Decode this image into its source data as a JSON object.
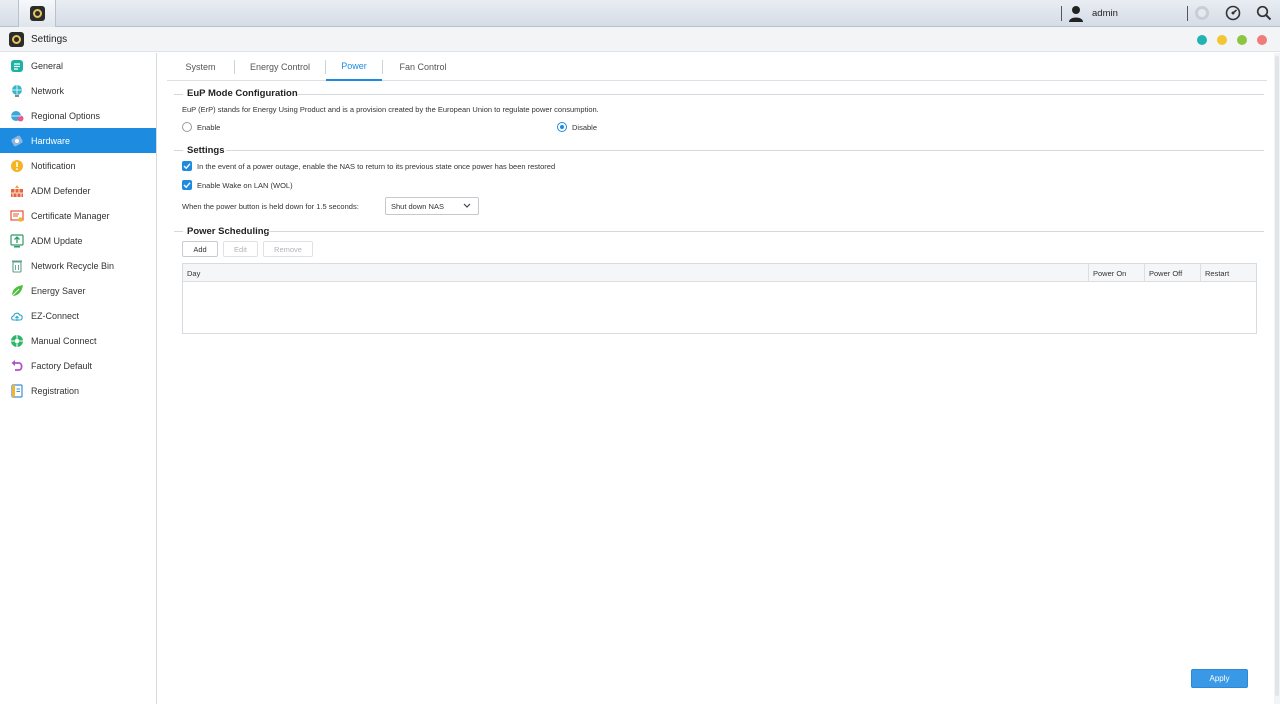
{
  "taskbar": {
    "username": "admin",
    "app_icon": "settings-gear-icon",
    "icons": [
      "user-icon",
      "notification-icon",
      "dashboard-icon",
      "search-icon"
    ]
  },
  "window": {
    "title": "Settings",
    "controls": [
      {
        "name": "teal",
        "color": "#21b3b3"
      },
      {
        "name": "yellow",
        "color": "#f2c531"
      },
      {
        "name": "green",
        "color": "#8cc63f"
      },
      {
        "name": "red",
        "color": "#f07b7b"
      }
    ]
  },
  "sidebar": {
    "active": "Hardware",
    "items": [
      {
        "label": "General",
        "icon": "general-icon"
      },
      {
        "label": "Network",
        "icon": "network-globe-icon"
      },
      {
        "label": "Regional Options",
        "icon": "regional-globe-icon"
      },
      {
        "label": "Hardware",
        "icon": "hardware-icon"
      },
      {
        "label": "Notification",
        "icon": "notification-icon"
      },
      {
        "label": "ADM Defender",
        "icon": "defender-firewall-icon"
      },
      {
        "label": "Certificate Manager",
        "icon": "certificate-icon"
      },
      {
        "label": "ADM Update",
        "icon": "update-icon"
      },
      {
        "label": "Network Recycle Bin",
        "icon": "recycle-bin-icon"
      },
      {
        "label": "Energy Saver",
        "icon": "energy-leaf-icon"
      },
      {
        "label": "EZ-Connect",
        "icon": "cloud-upload-icon"
      },
      {
        "label": "Manual Connect",
        "icon": "manual-connect-icon"
      },
      {
        "label": "Factory Default",
        "icon": "undo-arrow-icon"
      },
      {
        "label": "Registration",
        "icon": "registration-icon"
      }
    ]
  },
  "tabs": [
    {
      "label": "System"
    },
    {
      "label": "Energy Control"
    },
    {
      "label": "Power"
    },
    {
      "label": "Fan Control"
    }
  ],
  "active_tab": "Power",
  "eup": {
    "title": "EuP Mode Configuration",
    "description": "EuP (ErP) stands for Energy Using Product and is a provision created by the European Union to regulate power consumption.",
    "enable_label": "Enable",
    "disable_label": "Disable",
    "selected": "Disable"
  },
  "settings": {
    "title": "Settings",
    "restore_power_label": "In the event of a power outage, enable the NAS to return to its previous state once power has been restored",
    "restore_power_checked": true,
    "wol_label": "Enable Wake on LAN (WOL)",
    "wol_checked": true,
    "power_button_label": "When the power button is held down for 1.5 seconds:",
    "power_button_value": "Shut down NAS"
  },
  "scheduling": {
    "title": "Power Scheduling",
    "add_label": "Add",
    "edit_label": "Edit",
    "remove_label": "Remove",
    "columns": [
      "Day",
      "Power On",
      "Power Off",
      "Restart"
    ],
    "rows": []
  },
  "apply_label": "Apply",
  "colors": {
    "accent": "#1d8ce0",
    "apply": "#3a99e6"
  }
}
